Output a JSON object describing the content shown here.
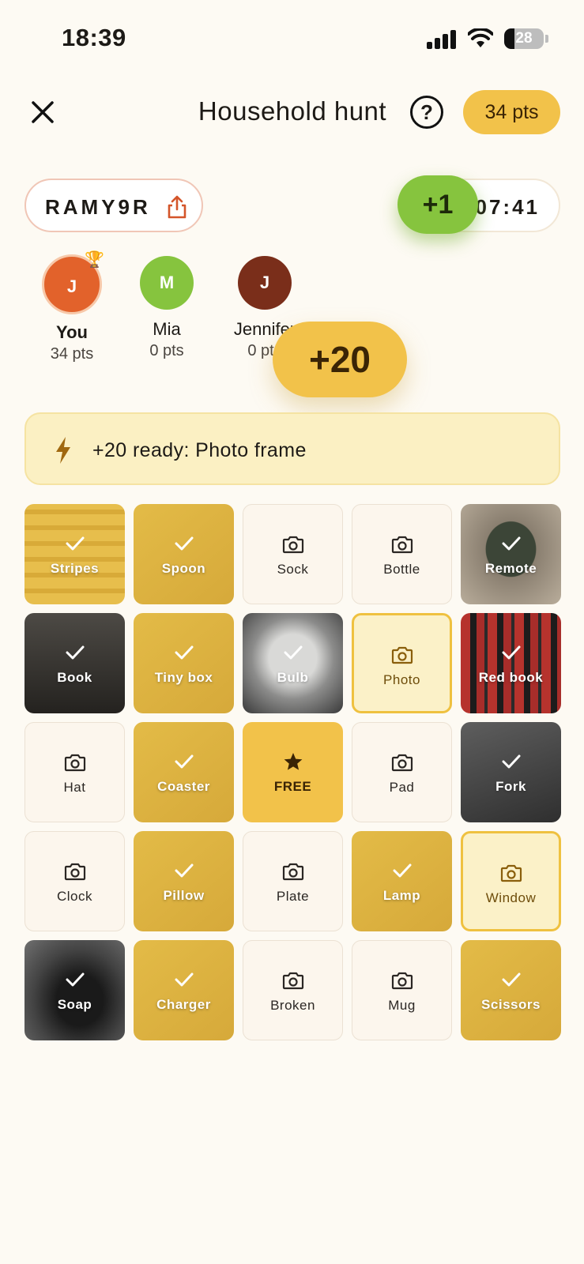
{
  "status_bar": {
    "time": "18:39",
    "battery": "28"
  },
  "header": {
    "title": "Household hunt",
    "help": "?",
    "points": "34 pts"
  },
  "room": {
    "code": "RAMY9R",
    "timer": "07:41",
    "bonus_float": "+1"
  },
  "players": [
    {
      "initial": "J",
      "name": "You",
      "points": "34 pts",
      "color": "#e2622b",
      "leader": true
    },
    {
      "initial": "M",
      "name": "Mia",
      "points": "0 pts",
      "color": "#86c43e"
    },
    {
      "initial": "J",
      "name": "Jennifer",
      "points": "0 pts",
      "color": "#7a2e1a"
    }
  ],
  "big_bonus": "+20",
  "bonus_banner": {
    "text": "+20 ready: Photo frame",
    "icon": "bolt-icon"
  },
  "grid": {
    "tiles": [
      {
        "label": "Stripes",
        "state": "found",
        "bg": "stripes"
      },
      {
        "label": "Spoon",
        "state": "found",
        "bg": "yellow"
      },
      {
        "label": "Sock",
        "state": "empty"
      },
      {
        "label": "Bottle",
        "state": "empty"
      },
      {
        "label": "Remote",
        "state": "found",
        "bg": "remote"
      },
      {
        "label": "Book",
        "state": "found",
        "bg": "book"
      },
      {
        "label": "Tiny box",
        "state": "found",
        "bg": "yellow"
      },
      {
        "label": "Bulb",
        "state": "found",
        "bg": "bulb"
      },
      {
        "label": "Photo",
        "state": "target"
      },
      {
        "label": "Red book",
        "state": "found",
        "bg": "redbook"
      },
      {
        "label": "Hat",
        "state": "empty"
      },
      {
        "label": "Coaster",
        "state": "found",
        "bg": "yellow"
      },
      {
        "label": "FREE",
        "state": "free"
      },
      {
        "label": "Pad",
        "state": "empty"
      },
      {
        "label": "Fork",
        "state": "found",
        "bg": "fork"
      },
      {
        "label": "Clock",
        "state": "empty"
      },
      {
        "label": "Pillow",
        "state": "found",
        "bg": "yellow"
      },
      {
        "label": "Plate",
        "state": "empty"
      },
      {
        "label": "Lamp",
        "state": "found",
        "bg": "yellow"
      },
      {
        "label": "Window",
        "state": "target"
      },
      {
        "label": "Soap",
        "state": "found",
        "bg": "soap"
      },
      {
        "label": "Charger",
        "state": "found",
        "bg": "yellow"
      },
      {
        "label": "Broken",
        "state": "empty"
      },
      {
        "label": "Mug",
        "state": "empty"
      },
      {
        "label": "Scissors",
        "state": "found",
        "bg": "yellow"
      }
    ]
  }
}
